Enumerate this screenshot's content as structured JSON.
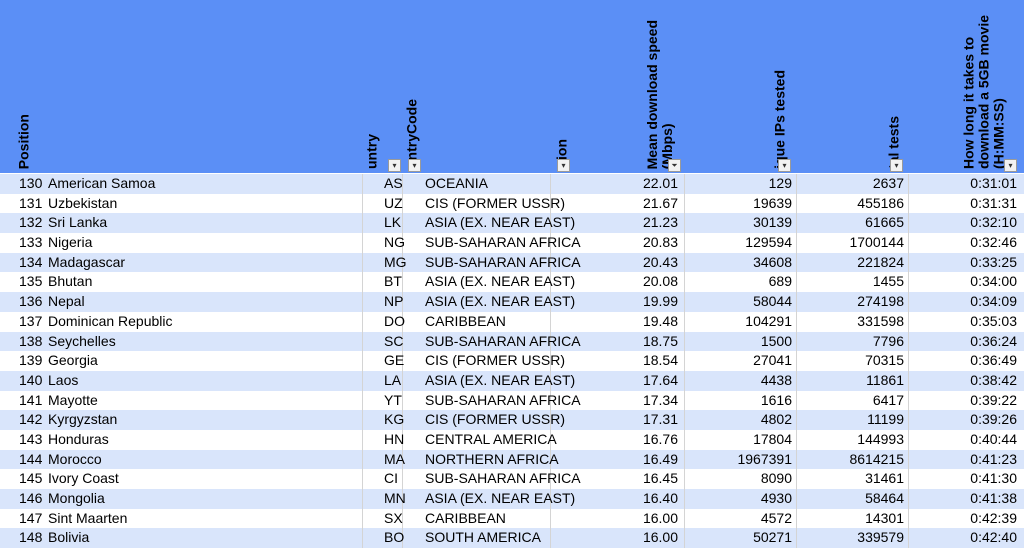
{
  "headers": {
    "position": "Position",
    "country": "untry",
    "country_code": "untryCode",
    "region": "gion",
    "mean_speed": "Mean download speed\n(Mbps)",
    "unique_ips": "ique IPs tested",
    "total_tests": "tal tests",
    "download_time": "How long it takes to\ndownload a 5GB movie\n(H:MM:SS)"
  },
  "filter_icons": {
    "dropdown": "▾",
    "sorted": "⏷"
  },
  "colors": {
    "header_bg": "#5b8ff6",
    "row_band": "#d9e5fb",
    "row_plain": "#ffffff"
  },
  "rows": [
    {
      "position": "130",
      "country": "American Samoa",
      "code": "AS",
      "region": "OCEANIA",
      "speed": "22.01",
      "ips": "129",
      "tests": "2637",
      "time": "0:31:01"
    },
    {
      "position": "131",
      "country": "Uzbekistan",
      "code": "UZ",
      "region": "CIS (FORMER USSR)",
      "speed": "21.67",
      "ips": "19639",
      "tests": "455186",
      "time": "0:31:31"
    },
    {
      "position": "132",
      "country": "Sri Lanka",
      "code": "LK",
      "region": "ASIA (EX. NEAR EAST)",
      "speed": "21.23",
      "ips": "30139",
      "tests": "61665",
      "time": "0:32:10"
    },
    {
      "position": "133",
      "country": "Nigeria",
      "code": "NG",
      "region": "SUB-SAHARAN AFRICA",
      "speed": "20.83",
      "ips": "129594",
      "tests": "1700144",
      "time": "0:32:46"
    },
    {
      "position": "134",
      "country": "Madagascar",
      "code": "MG",
      "region": "SUB-SAHARAN AFRICA",
      "speed": "20.43",
      "ips": "34608",
      "tests": "221824",
      "time": "0:33:25"
    },
    {
      "position": "135",
      "country": "Bhutan",
      "code": "BT",
      "region": "ASIA (EX. NEAR EAST)",
      "speed": "20.08",
      "ips": "689",
      "tests": "1455",
      "time": "0:34:00"
    },
    {
      "position": "136",
      "country": "Nepal",
      "code": "NP",
      "region": "ASIA (EX. NEAR EAST)",
      "speed": "19.99",
      "ips": "58044",
      "tests": "274198",
      "time": "0:34:09"
    },
    {
      "position": "137",
      "country": "Dominican Republic",
      "code": "DO",
      "region": "CARIBBEAN",
      "speed": "19.48",
      "ips": "104291",
      "tests": "331598",
      "time": "0:35:03"
    },
    {
      "position": "138",
      "country": "Seychelles",
      "code": "SC",
      "region": "SUB-SAHARAN AFRICA",
      "speed": "18.75",
      "ips": "1500",
      "tests": "7796",
      "time": "0:36:24"
    },
    {
      "position": "139",
      "country": "Georgia",
      "code": "GE",
      "region": "CIS (FORMER USSR)",
      "speed": "18.54",
      "ips": "27041",
      "tests": "70315",
      "time": "0:36:49"
    },
    {
      "position": "140",
      "country": "Laos",
      "code": "LA",
      "region": "ASIA (EX. NEAR EAST)",
      "speed": "17.64",
      "ips": "4438",
      "tests": "11861",
      "time": "0:38:42"
    },
    {
      "position": "141",
      "country": "Mayotte",
      "code": "YT",
      "region": "SUB-SAHARAN AFRICA",
      "speed": "17.34",
      "ips": "1616",
      "tests": "6417",
      "time": "0:39:22"
    },
    {
      "position": "142",
      "country": "Kyrgyzstan",
      "code": "KG",
      "region": "CIS (FORMER USSR)",
      "speed": "17.31",
      "ips": "4802",
      "tests": "11199",
      "time": "0:39:26"
    },
    {
      "position": "143",
      "country": "Honduras",
      "code": "HN",
      "region": "CENTRAL AMERICA",
      "speed": "16.76",
      "ips": "17804",
      "tests": "144993",
      "time": "0:40:44"
    },
    {
      "position": "144",
      "country": "Morocco",
      "code": "MA",
      "region": "NORTHERN AFRICA",
      "speed": "16.49",
      "ips": "1967391",
      "tests": "8614215",
      "time": "0:41:23"
    },
    {
      "position": "145",
      "country": "Ivory Coast",
      "code": "CI",
      "region": "SUB-SAHARAN AFRICA",
      "speed": "16.45",
      "ips": "8090",
      "tests": "31461",
      "time": "0:41:30"
    },
    {
      "position": "146",
      "country": "Mongolia",
      "code": "MN",
      "region": "ASIA (EX. NEAR EAST)",
      "speed": "16.40",
      "ips": "4930",
      "tests": "58464",
      "time": "0:41:38"
    },
    {
      "position": "147",
      "country": "Sint Maarten",
      "code": "SX",
      "region": "CARIBBEAN",
      "speed": "16.00",
      "ips": "4572",
      "tests": "14301",
      "time": "0:42:39"
    },
    {
      "position": "148",
      "country": "Bolivia",
      "code": "BO",
      "region": "SOUTH AMERICA",
      "speed": "16.00",
      "ips": "50271",
      "tests": "339579",
      "time": "0:42:40"
    }
  ]
}
